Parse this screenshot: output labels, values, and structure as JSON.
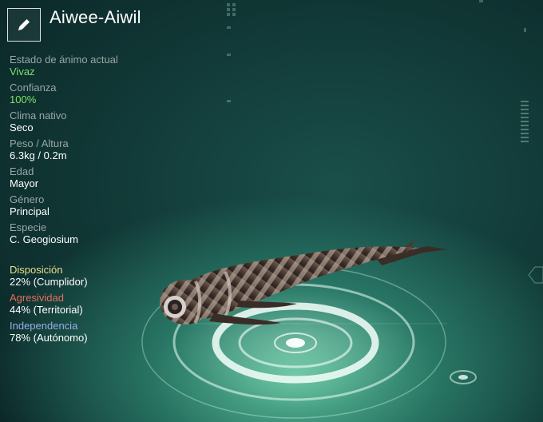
{
  "creature": {
    "name": "Aiwee-Aiwil"
  },
  "stats": [
    {
      "label": "Estado de ánimo actual",
      "value": "Vivaz",
      "highlight": true
    },
    {
      "label": "Confianza",
      "value": "100%",
      "highlight": true
    },
    {
      "label": "Clima nativo",
      "value": "Seco",
      "highlight": false
    },
    {
      "label": "Peso / Altura",
      "value": "6.3kg / 0.2m",
      "highlight": false
    },
    {
      "label": "Edad",
      "value": "Mayor",
      "highlight": false
    },
    {
      "label": "Género",
      "value": "Principal",
      "highlight": false
    },
    {
      "label": "Especie",
      "value": "C. Geogiosium",
      "highlight": false
    }
  ],
  "traits": [
    {
      "label": "Disposición",
      "value": "22% (Cumplidor)",
      "color": "#e6e08a"
    },
    {
      "label": "Agresividad",
      "value": "44% (Territorial)",
      "color": "#e0705a"
    },
    {
      "label": "Independencia",
      "value": "78% (Autónomo)",
      "color": "#9aaee6"
    }
  ],
  "icons": {
    "edit": "pencil-icon"
  },
  "colors": {
    "highlight_green": "#7ee06a",
    "label_gray": "#9aa6a6"
  }
}
